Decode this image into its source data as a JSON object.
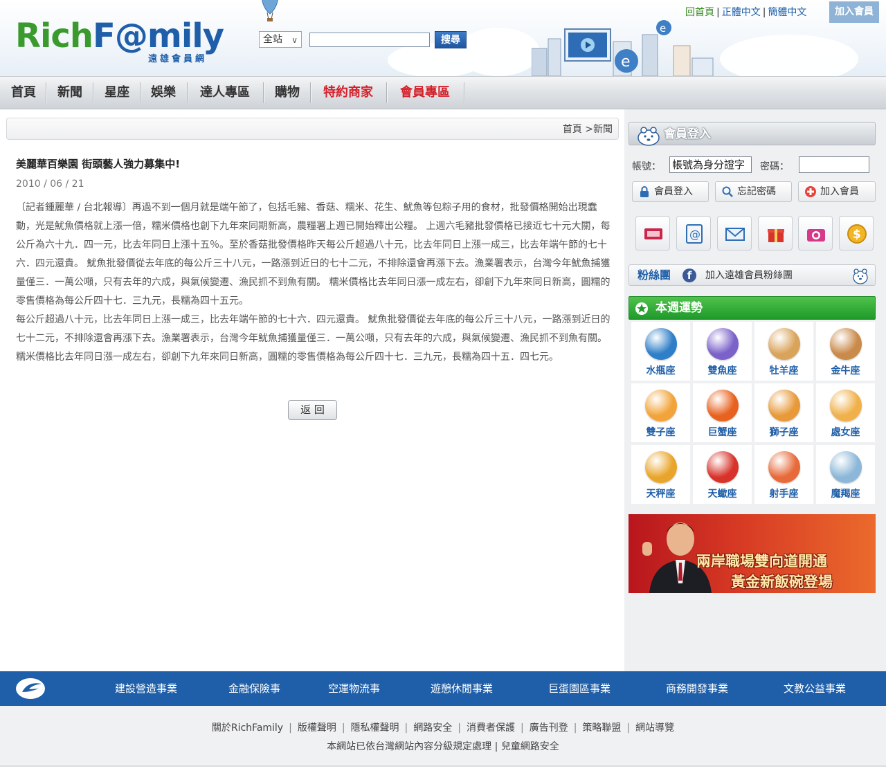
{
  "header": {
    "logo_part1": "Rich",
    "logo_part2": "F@mily",
    "logo_sub": "遠雄會員網",
    "search_scope": "全站",
    "search_placeholder": "",
    "search_button": "搜尋",
    "top_links": {
      "home": "回首頁",
      "trad": "正體中文",
      "simp": "簡體中文",
      "separator": "|"
    },
    "join_button": "加入會員"
  },
  "nav": {
    "items": [
      {
        "label": "首頁",
        "highlight": false
      },
      {
        "label": "新聞",
        "highlight": false
      },
      {
        "label": "星座",
        "highlight": false
      },
      {
        "label": "娛樂",
        "highlight": false
      },
      {
        "label": "達人專區",
        "highlight": false
      },
      {
        "label": "購物",
        "highlight": false
      },
      {
        "label": "特約商家",
        "highlight": true
      },
      {
        "label": "會員專區",
        "highlight": true
      }
    ]
  },
  "breadcrumb": "首頁 >新聞",
  "article": {
    "title": "美麗華百樂園 街頭藝人強力募集中!",
    "date": "2010 / 06 / 21",
    "paragraphs": [
      "〔記者鍾麗華 / 台北報導〕再過不到一個月就是端午節了，包括毛豬、香菇、糯米、花生、魷魚等包粽子用的食材，批發價格開始出現蠢動，光是魷魚價格就上漲一倍，糯米價格也創下九年來同期新高，農糧署上週已開始釋出公糧。 上週六毛豬批發價格已接近七十元大關，每公斤為六十九．四一元，比去年同日上漲十五％。至於香菇批發價格昨天每公斤超過八十元，比去年同日上漲一成三，比去年端午節的七十六．四元還貴。 魷魚批發價從去年底的每公斤三十八元，一路漲到近日的七十二元，不排除還會再漲下去。漁業署表示，台灣今年魷魚捕獲量僅三．一萬公噸，只有去年的六成，與氣候變遷、漁民抓不到魚有關。 糯米價格比去年同日漲一成左右，卻創下九年來同日新高，圓糯的零售價格為每公斤四十七．三九元，長糯為四十五元。",
      "每公斤超過八十元，比去年同日上漲一成三，比去年端午節的七十六．四元還貴。 魷魚批發價從去年底的每公斤三十八元，一路漲到近日的七十二元，不排除還會再漲下去。漁業署表示，台灣今年魷魚捕獲量僅三．一萬公噸，只有去年的六成，與氣候變遷、漁民抓不到魚有關。 糯米價格比去年同日漲一成左右，卻創下九年來同日新高，圓糯的零售價格為每公斤四十七．三九元，長糯為四十五．四七元。"
    ],
    "back_button": "返 回"
  },
  "sidebar": {
    "login": {
      "title": "會員登入",
      "account_label": "帳號：",
      "account_value": "帳號為身分證字",
      "password_label": "密碼：",
      "buttons": {
        "login": "會員登入",
        "forgot": "忘記密碼",
        "join": "加入會員"
      }
    },
    "quick_icons": [
      "ticket-icon",
      "email-at-icon",
      "mail-icon",
      "gift-icon",
      "camera-icon",
      "coin-icon"
    ],
    "fans": {
      "title": "粉絲團",
      "text": "加入遠雄會員粉絲團"
    },
    "horoscope": {
      "title": "本週運勢",
      "signs": [
        {
          "name": "水瓶座",
          "color": "#2f7fc8"
        },
        {
          "name": "雙魚座",
          "color": "#7b62c9"
        },
        {
          "name": "牡羊座",
          "color": "#d9a35a"
        },
        {
          "name": "金牛座",
          "color": "#c98a4a"
        },
        {
          "name": "雙子座",
          "color": "#f2a43a"
        },
        {
          "name": "巨蟹座",
          "color": "#e8621f"
        },
        {
          "name": "獅子座",
          "color": "#e89a3a"
        },
        {
          "name": "處女座",
          "color": "#f0b04a"
        },
        {
          "name": "天秤座",
          "color": "#e9a52b"
        },
        {
          "name": "天蠍座",
          "color": "#d7332a"
        },
        {
          "name": "射手座",
          "color": "#e76a3a"
        },
        {
          "name": "魔羯座",
          "color": "#8cb7d8"
        }
      ]
    },
    "banner": {
      "line1": "兩岸職場雙向道開通",
      "line2": "黃金新飯碗登場"
    }
  },
  "footer": {
    "nav": [
      "建設營造事業",
      "金融保險事",
      "空運物流事",
      "遊憩休閒事業",
      "巨蛋園區事業",
      "商務開發事業",
      "文教公益事業"
    ],
    "links": [
      "關於RichFamily",
      "版權聲明",
      "隱私權聲明",
      "網路安全",
      "消費者保護",
      "廣告刊登",
      "策略聯盟",
      "網站導覽"
    ],
    "note": "本網站已依台灣網站內容分級規定處理",
    "note_link": "兒童網路安全",
    "separator": "|"
  },
  "colors": {
    "brand_blue": "#1f5fa9",
    "brand_green": "#3a9a2e",
    "highlight_red": "#d4202a",
    "horoscope_green": "#1f9a2b"
  }
}
